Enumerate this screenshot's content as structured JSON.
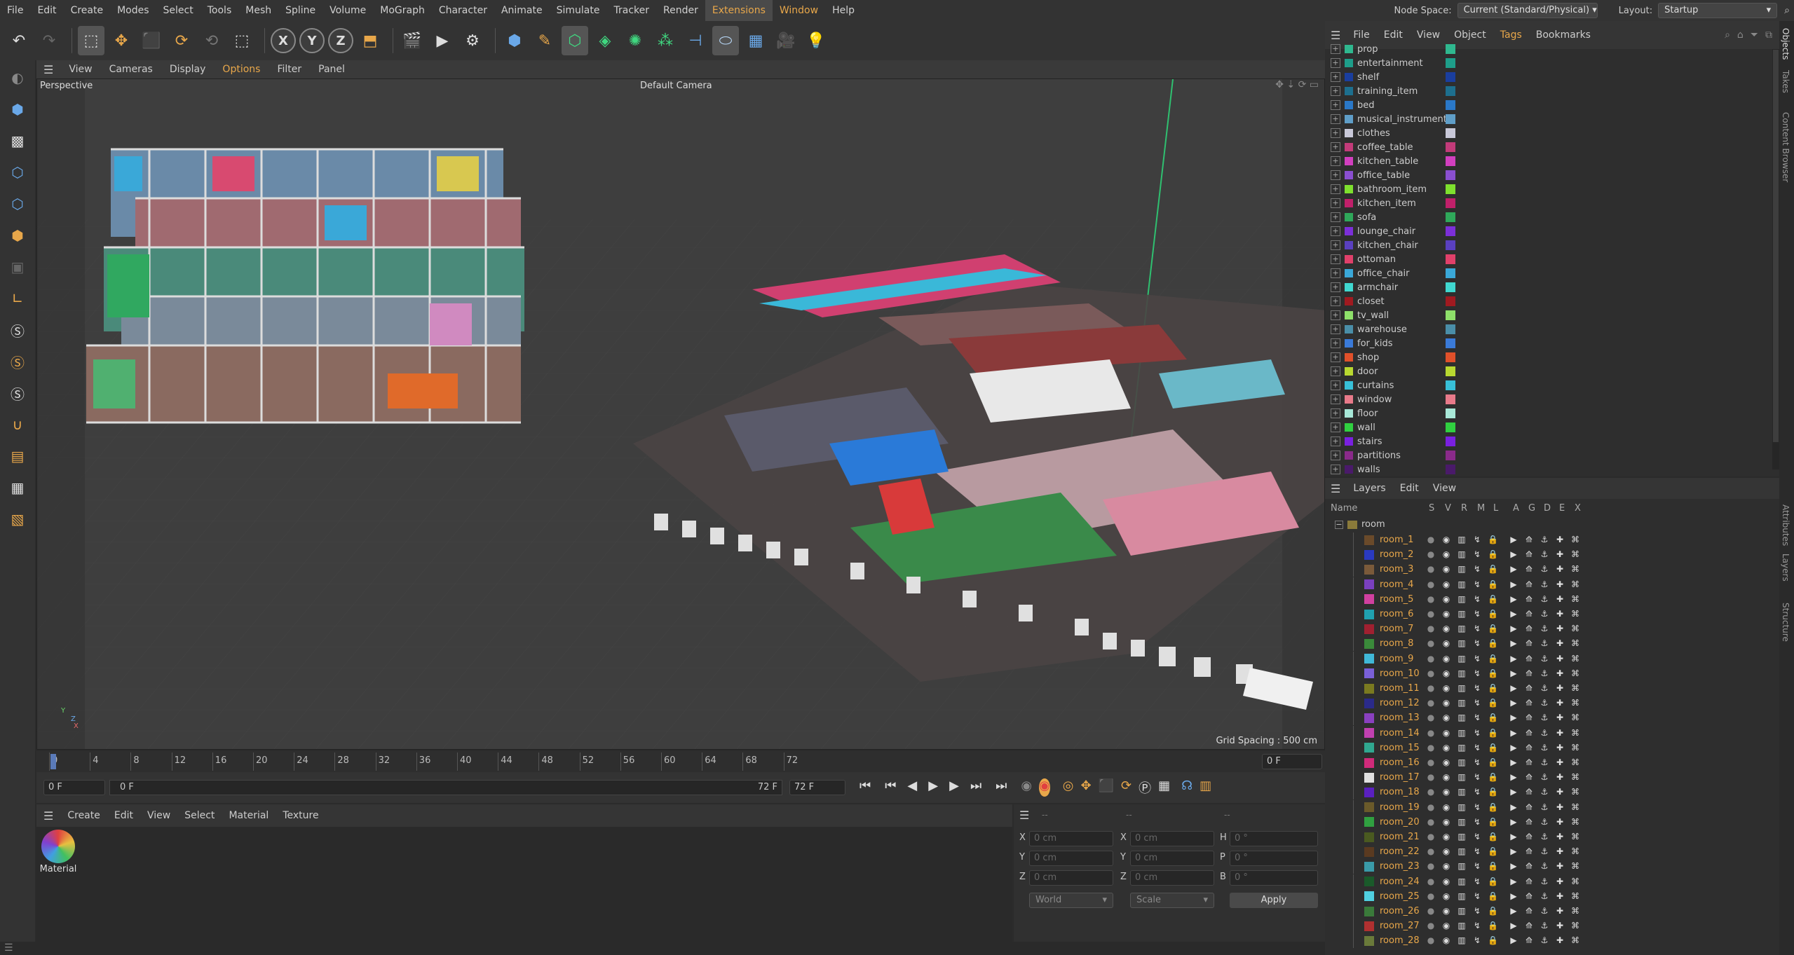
{
  "menubar": {
    "items": [
      "File",
      "Edit",
      "Create",
      "Modes",
      "Select",
      "Tools",
      "Mesh",
      "Spline",
      "Volume",
      "MoGraph",
      "Character",
      "Animate",
      "Simulate",
      "Tracker",
      "Render",
      "Extensions",
      "Window",
      "Help"
    ],
    "node_space_label": "Node Space:",
    "node_space_value": "Current (Standard/Physical)",
    "layout_label": "Layout:",
    "layout_value": "Startup"
  },
  "viewport": {
    "menu": [
      "View",
      "Cameras",
      "Display",
      "Options",
      "Filter",
      "Panel"
    ],
    "label": "Perspective",
    "camera": "Default Camera",
    "grid_spacing": "Grid Spacing : 500 cm",
    "axes": {
      "y": "Y",
      "z": "Z",
      "x": "X"
    }
  },
  "timeline": {
    "ticks": [
      "0",
      "4",
      "8",
      "12",
      "16",
      "20",
      "24",
      "28",
      "32",
      "36",
      "40",
      "44",
      "48",
      "52",
      "56",
      "60",
      "64",
      "68",
      "72"
    ],
    "current_frame_right": "0 F",
    "start_frame": "0 F",
    "range_start": "0 F",
    "range_end": "72 F",
    "end_frame": "72 F"
  },
  "material_manager": {
    "menu": [
      "Create",
      "Edit",
      "View",
      "Select",
      "Material",
      "Texture"
    ],
    "material_name": "Material"
  },
  "attributes": {
    "header1": "--",
    "header2": "--",
    "header3": "--",
    "rows": [
      {
        "l1": "X",
        "v1": "0 cm",
        "l2": "X",
        "v2": "0 cm",
        "l3": "H",
        "v3": "0 °"
      },
      {
        "l1": "Y",
        "v1": "0 cm",
        "l2": "Y",
        "v2": "0 cm",
        "l3": "P",
        "v3": "0 °"
      },
      {
        "l1": "Z",
        "v1": "0 cm",
        "l2": "Z",
        "v2": "0 cm",
        "l3": "B",
        "v3": "0 °"
      }
    ],
    "coord_mode": "World",
    "size_mode": "Scale",
    "apply_label": "Apply"
  },
  "objects": {
    "menu": [
      "File",
      "Edit",
      "View",
      "Object",
      "Tags",
      "Bookmarks"
    ],
    "items": [
      {
        "name": "prop",
        "color": "#2fb88f"
      },
      {
        "name": "entertainment",
        "color": "#1e9e8a"
      },
      {
        "name": "shelf",
        "color": "#1a3e9e"
      },
      {
        "name": "training_item",
        "color": "#1d6f8e"
      },
      {
        "name": "bed",
        "color": "#2a78c8"
      },
      {
        "name": "musical_instrument",
        "color": "#5f9ec8"
      },
      {
        "name": "clothes",
        "color": "#c8c8d8"
      },
      {
        "name": "coffee_table",
        "color": "#c23b7a"
      },
      {
        "name": "kitchen_table",
        "color": "#d23fbf"
      },
      {
        "name": "office_table",
        "color": "#8a4fd0"
      },
      {
        "name": "bathroom_item",
        "color": "#7ee02e"
      },
      {
        "name": "kitchen_item",
        "color": "#c0206a"
      },
      {
        "name": "sofa",
        "color": "#2fa85a"
      },
      {
        "name": "lounge_chair",
        "color": "#7c2fd8"
      },
      {
        "name": "kitchen_chair",
        "color": "#5a40c0"
      },
      {
        "name": "ottoman",
        "color": "#e0406a"
      },
      {
        "name": "office_chair",
        "color": "#3aa8d8"
      },
      {
        "name": "armchair",
        "color": "#40d8d0"
      },
      {
        "name": "closet",
        "color": "#a01a20"
      },
      {
        "name": "tv_wall",
        "color": "#8ee06a"
      },
      {
        "name": "warehouse",
        "color": "#4a8ea8"
      },
      {
        "name": "for_kids",
        "color": "#3a7ad8"
      },
      {
        "name": "shop",
        "color": "#e0502a"
      },
      {
        "name": "door",
        "color": "#b8d830"
      },
      {
        "name": "curtains",
        "color": "#38c0d8"
      },
      {
        "name": "window",
        "color": "#e87a8a"
      },
      {
        "name": "floor",
        "color": "#a8e8d8"
      },
      {
        "name": "wall",
        "color": "#30d040"
      },
      {
        "name": "stairs",
        "color": "#7a20e0"
      },
      {
        "name": "partitions",
        "color": "#8a2a8a"
      },
      {
        "name": "walls",
        "color": "#4a1a6a"
      }
    ]
  },
  "layers": {
    "menu": [
      "Layers",
      "Edit",
      "View"
    ],
    "columns": [
      "Name",
      "S",
      "V",
      "R",
      "M",
      "L",
      "A",
      "G",
      "D",
      "E",
      "X"
    ],
    "parent": "room",
    "items": [
      {
        "name": "room_1",
        "color": "#6a4a2a"
      },
      {
        "name": "room_2",
        "color": "#2a3ac0"
      },
      {
        "name": "room_3",
        "color": "#7a5a3a"
      },
      {
        "name": "room_4",
        "color": "#7a40c0"
      },
      {
        "name": "room_5",
        "color": "#d040a0"
      },
      {
        "name": "room_6",
        "color": "#20a0b0"
      },
      {
        "name": "room_7",
        "color": "#a02030"
      },
      {
        "name": "room_8",
        "color": "#3a8a3a"
      },
      {
        "name": "room_9",
        "color": "#40b8d8"
      },
      {
        "name": "room_10",
        "color": "#7a60d8"
      },
      {
        "name": "room_11",
        "color": "#7a7a20"
      },
      {
        "name": "room_12",
        "color": "#2a2a8a"
      },
      {
        "name": "room_13",
        "color": "#8a40c0"
      },
      {
        "name": "room_14",
        "color": "#c040b0"
      },
      {
        "name": "room_15",
        "color": "#30a890"
      },
      {
        "name": "room_16",
        "color": "#d02a7a"
      },
      {
        "name": "room_17",
        "color": "#e0e0e0"
      },
      {
        "name": "room_18",
        "color": "#5a20c0"
      },
      {
        "name": "room_19",
        "color": "#6a5a2a"
      },
      {
        "name": "room_20",
        "color": "#30a040"
      },
      {
        "name": "room_21",
        "color": "#4a5a20"
      },
      {
        "name": "room_22",
        "color": "#5a3a20"
      },
      {
        "name": "room_23",
        "color": "#3a9aa8"
      },
      {
        "name": "room_24",
        "color": "#1a5a2a"
      },
      {
        "name": "room_25",
        "color": "#50d0e0"
      },
      {
        "name": "room_26",
        "color": "#3a7a3a"
      },
      {
        "name": "room_27",
        "color": "#b03030"
      },
      {
        "name": "room_28",
        "color": "#6a7a3a"
      }
    ]
  },
  "sidetabs": [
    "Objects",
    "Takes",
    "Content Browser",
    "Attributes",
    "Layers",
    "Structure"
  ]
}
